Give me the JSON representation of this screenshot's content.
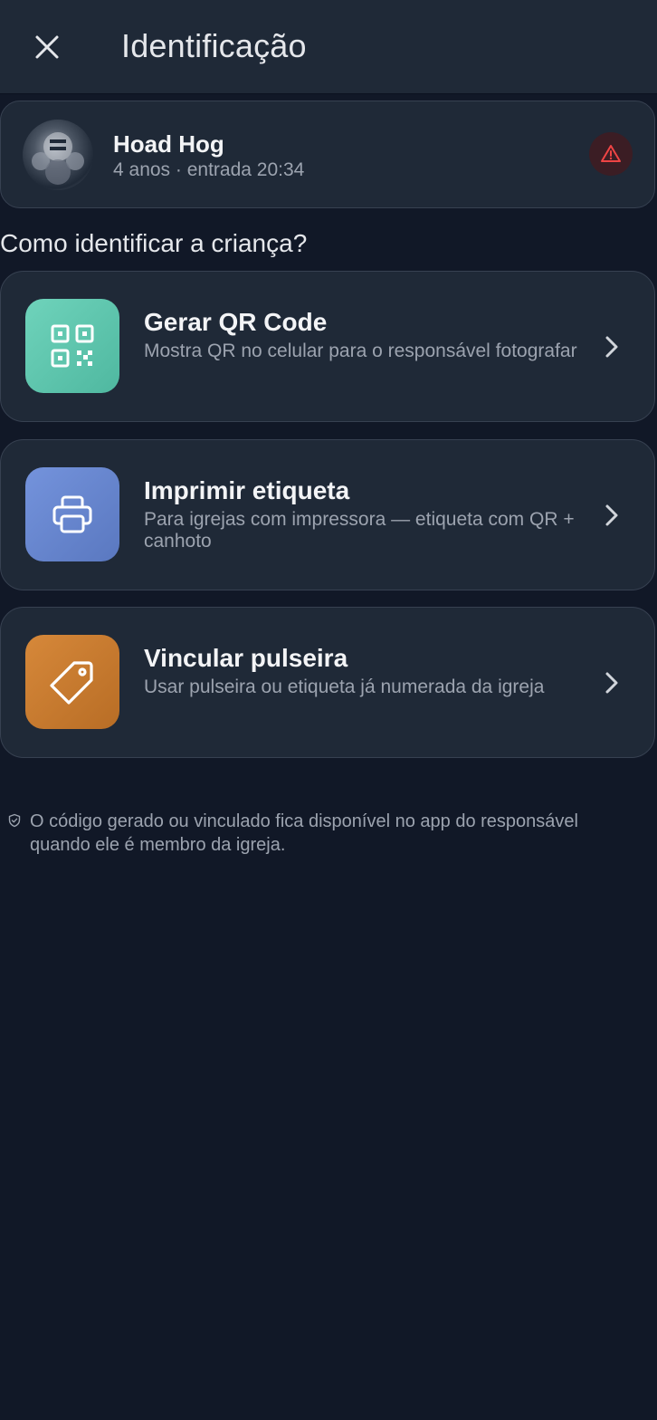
{
  "header": {
    "title": "Identificação",
    "close_icon": "close-icon"
  },
  "child": {
    "name": "Hoad Hog",
    "meta": "4 anos · entrada 20:34",
    "alert_icon": "warning-triangle-icon",
    "alert_color": "#ef4444"
  },
  "question": "Como identificar a criança?",
  "options": [
    {
      "title": "Gerar QR Code",
      "description": "Mostra QR no celular para o responsável fotografar",
      "icon": "qr-code-icon",
      "color": "#5fc8b0"
    },
    {
      "title": "Imprimir etiqueta",
      "description": "Para igrejas com impressora — etiqueta com QR + canhoto",
      "icon": "printer-icon",
      "color": "#6483cc"
    },
    {
      "title": "Vincular pulseira",
      "description": "Usar pulseira ou etiqueta já numerada da igreja",
      "icon": "tag-icon",
      "color": "#c97a2e"
    }
  ],
  "footnote": {
    "icon": "shield-check-icon",
    "text": "O código gerado ou vinculado fica disponível no app do responsável quando ele é membro da igreja."
  }
}
